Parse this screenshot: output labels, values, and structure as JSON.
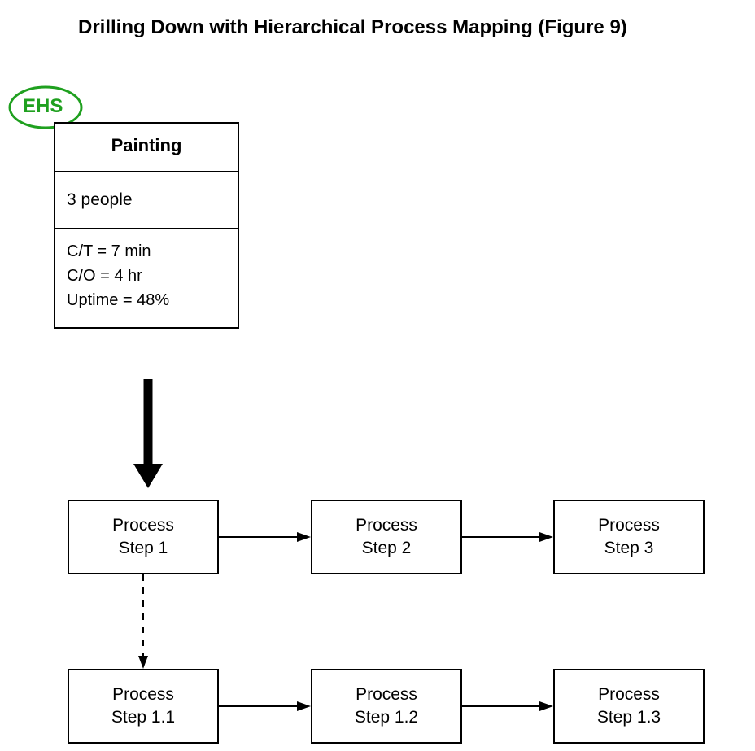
{
  "title": "Drilling Down with Hierarchical Process Mapping (Figure 9)",
  "ehs": {
    "label": "EHS"
  },
  "processBox": {
    "header": "Painting",
    "people": "3 people",
    "ct": "C/T = 7 min",
    "co": "C/O = 4 hr",
    "uptime": "Uptime = 48%"
  },
  "steps": {
    "row1": {
      "s1": {
        "line1": "Process",
        "line2": "Step 1"
      },
      "s2": {
        "line1": "Process",
        "line2": "Step 2"
      },
      "s3": {
        "line1": "Process",
        "line2": "Step 3"
      }
    },
    "row2": {
      "s1": {
        "line1": "Process",
        "line2": "Step 1.1"
      },
      "s2": {
        "line1": "Process",
        "line2": "Step 1.2"
      },
      "s3": {
        "line1": "Process",
        "line2": "Step 1.3"
      }
    }
  }
}
